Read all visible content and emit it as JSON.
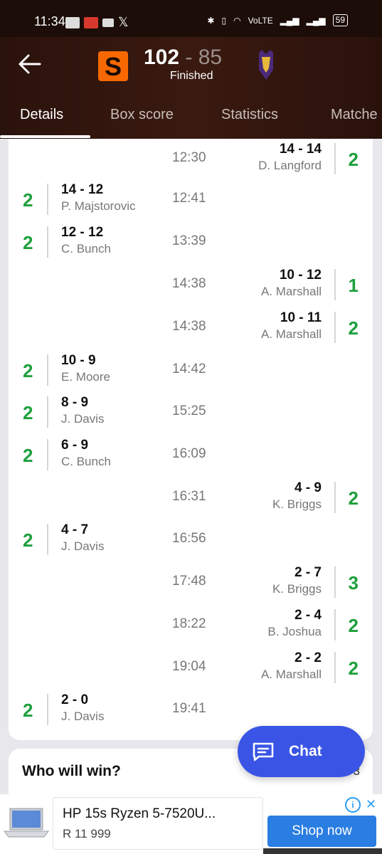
{
  "status_bar": {
    "time": "11:34",
    "battery": "59",
    "network": "VoLTE"
  },
  "header": {
    "home_score": "102",
    "separator": "-",
    "away_score": "85",
    "status": "Finished"
  },
  "tabs": [
    {
      "label": "Details"
    },
    {
      "label": "Box score"
    },
    {
      "label": "Statistics"
    },
    {
      "label": "Matche"
    }
  ],
  "plays": [
    {
      "side": "right",
      "score": "14 - 14",
      "player": "D. Langford",
      "time": "12:30",
      "points": "2"
    },
    {
      "side": "left",
      "score": "14 - 12",
      "player": "P. Majstorovic",
      "time": "12:41",
      "points": "2"
    },
    {
      "side": "left",
      "score": "12 - 12",
      "player": "C. Bunch",
      "time": "13:39",
      "points": "2"
    },
    {
      "side": "right",
      "score": "10 - 12",
      "player": "A. Marshall",
      "time": "14:38",
      "points": "1"
    },
    {
      "side": "right",
      "score": "10 - 11",
      "player": "A. Marshall",
      "time": "14:38",
      "points": "2"
    },
    {
      "side": "left",
      "score": "10 - 9",
      "player": "E. Moore",
      "time": "14:42",
      "points": "2"
    },
    {
      "side": "left",
      "score": "8 - 9",
      "player": "J. Davis",
      "time": "15:25",
      "points": "2"
    },
    {
      "side": "left",
      "score": "6 - 9",
      "player": "C. Bunch",
      "time": "16:09",
      "points": "2"
    },
    {
      "side": "right",
      "score": "4 - 9",
      "player": "K. Briggs",
      "time": "16:31",
      "points": "2"
    },
    {
      "side": "left",
      "score": "4 - 7",
      "player": "J. Davis",
      "time": "16:56",
      "points": "2"
    },
    {
      "side": "right",
      "score": "2 - 7",
      "player": "K. Briggs",
      "time": "17:48",
      "points": "3"
    },
    {
      "side": "right",
      "score": "2 - 4",
      "player": "B. Joshua",
      "time": "18:22",
      "points": "2"
    },
    {
      "side": "right",
      "score": "2 - 2",
      "player": "A. Marshall",
      "time": "19:04",
      "points": "2"
    },
    {
      "side": "left",
      "score": "2 - 0",
      "player": "J. Davis",
      "time": "19:41",
      "points": "2"
    }
  ],
  "who_will_win": {
    "title": "Who will win?",
    "partial": "3"
  },
  "chat": {
    "label": "Chat"
  },
  "ad": {
    "title": "HP 15s Ryzen 5-7520U...",
    "price": "R 11 999",
    "cta": "Shop now"
  },
  "colors": {
    "points": "#1ea03d",
    "chat": "#3a55e6",
    "header_bg": "#2a120c"
  }
}
